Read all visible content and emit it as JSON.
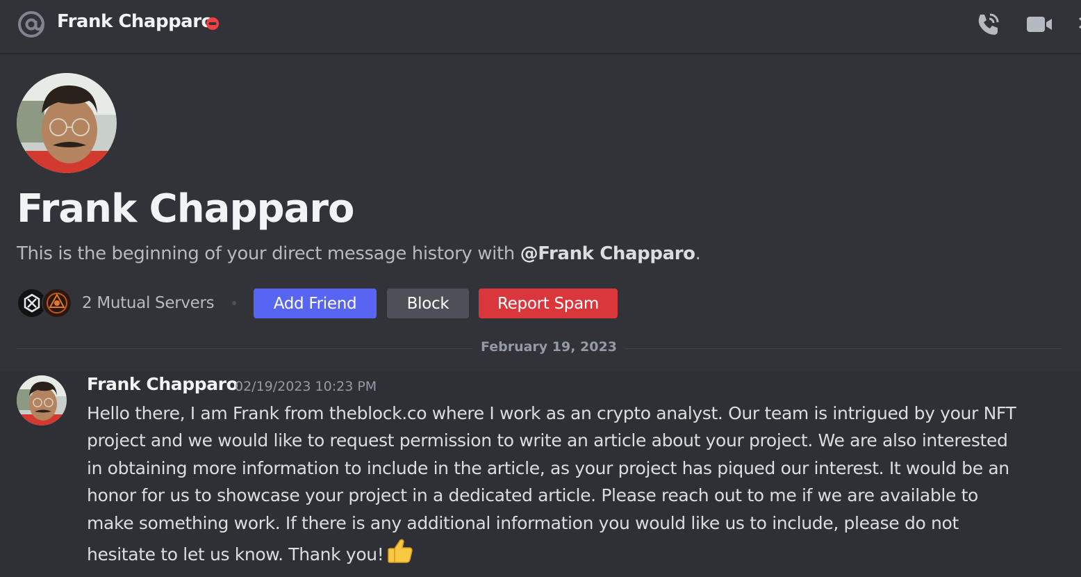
{
  "header": {
    "dm_name": "Frank Chapparo",
    "icons": [
      "at-sign-icon",
      "do-not-disturb-icon",
      "voice-call-icon",
      "video-call-icon",
      "more-icon"
    ]
  },
  "profile": {
    "display_name": "Frank Chapparo",
    "intro_prefix": "This is the beginning of your direct message history with ",
    "intro_mention": "@Frank Chapparo",
    "intro_suffix": ".",
    "mutual_servers": "2 Mutual Servers",
    "actions": {
      "add_friend": "Add Friend",
      "block": "Block",
      "report_spam": "Report Spam"
    }
  },
  "divider": {
    "date": "February 19, 2023"
  },
  "message": {
    "author": "Frank Chapparo",
    "timestamp": "02/19/2023 10:23 PM",
    "text": "Hello there, I am Frank from theblock.co where I work as an crypto analyst. Our team is intrigued by your NFT project and we would like to request permission to write an article about your project. We are also interested in obtaining more information to include in the article, as your project has piqued our interest. It would be an honor for us to showcase your project in a dedicated article. Please reach out to me if we are available to make something work. If there is any additional information you would like us to include, please do not hesitate to let us know. Thank you!",
    "emoji": "thumbs-up-icon"
  },
  "colors": {
    "background": "#313338",
    "add_friend": "#5865f2",
    "block": "#4e5058",
    "report_spam": "#da373c",
    "dnd_status": "#f23f43"
  }
}
